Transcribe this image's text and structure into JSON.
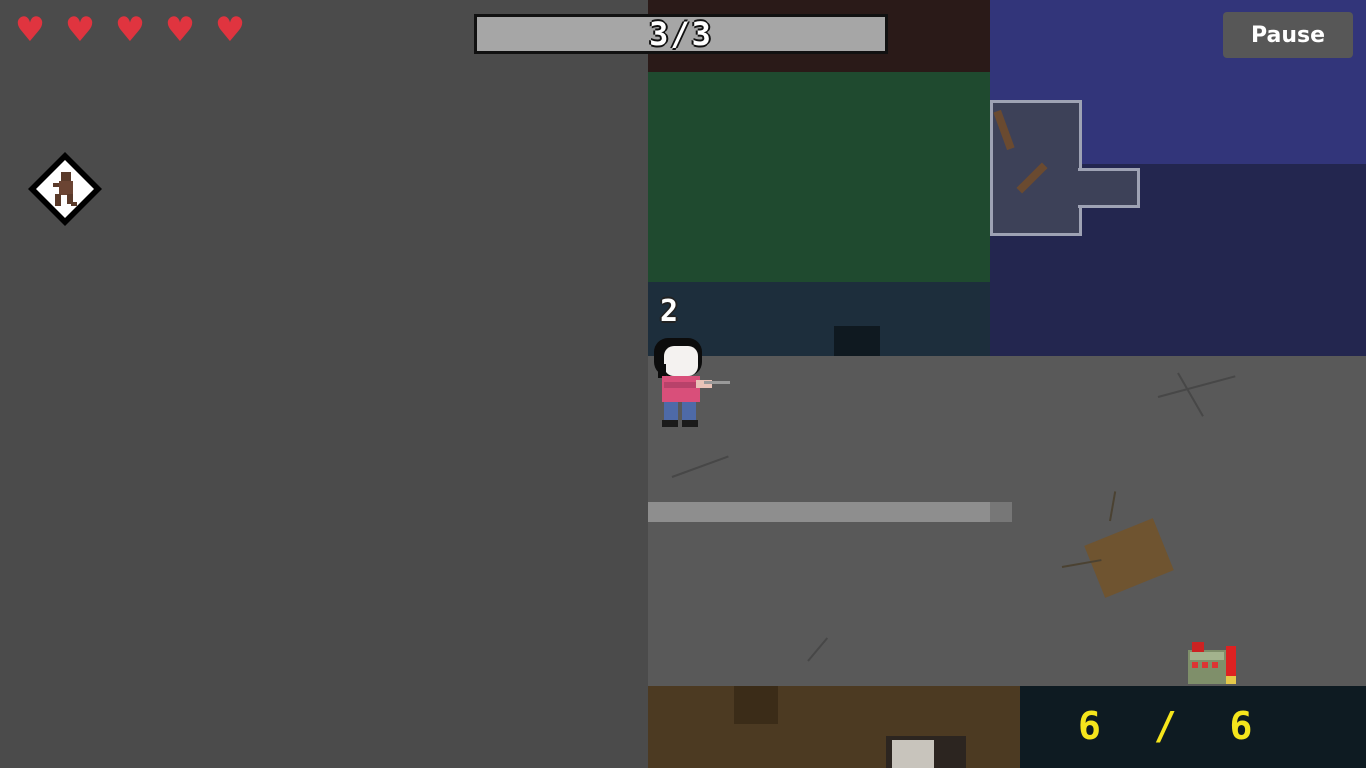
{
  "hud": {
    "health": {
      "hearts_full": 5,
      "hearts_total": 5,
      "icon": "heart-icon",
      "color": "#e0343f"
    },
    "wave_progress_text": "3/3",
    "pause_label": "Pause",
    "kill_count": "2",
    "ammo": {
      "text": "6 / 6",
      "icon": "shotgun-shells-icon"
    }
  },
  "ability": {
    "icon": "running-figure-icon"
  },
  "colors": {
    "background_void": "#4b4b4b",
    "wave_bar_fill": "#a6a6a6",
    "ammo_text": "#f5e51c",
    "grass": "#1f4a2f",
    "night_sky": "#272b5e"
  }
}
